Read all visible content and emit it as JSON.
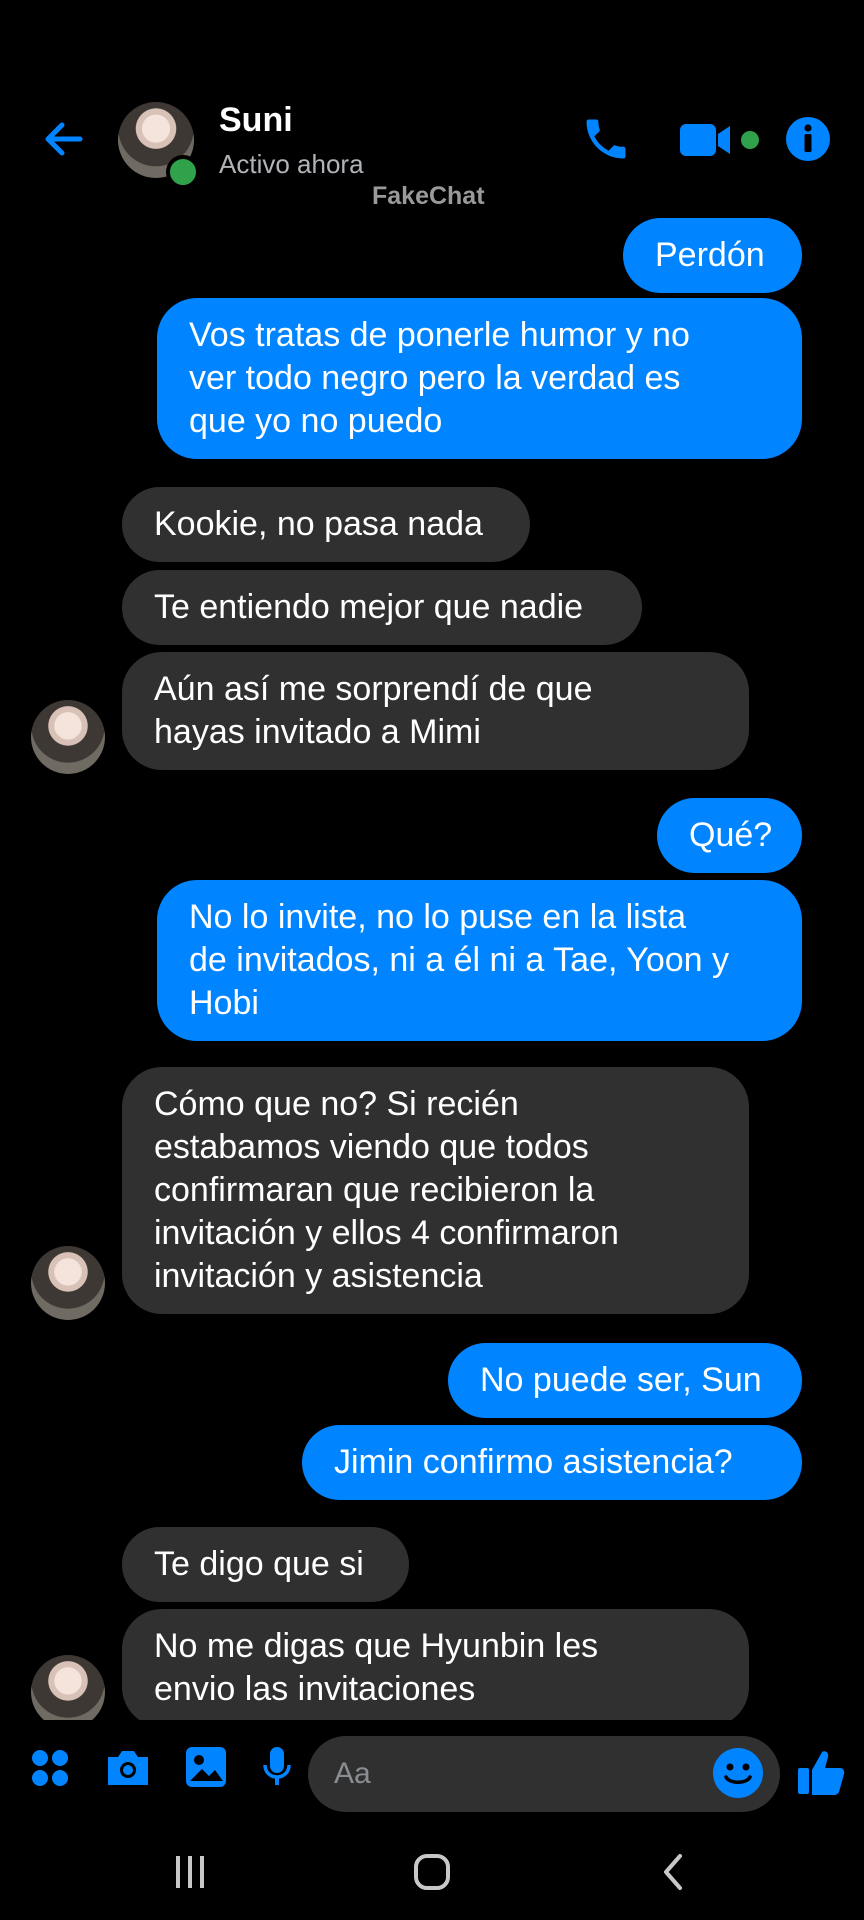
{
  "contact": {
    "name": "Suni",
    "status": "Activo ahora"
  },
  "watermark": "FakeChat",
  "colors": {
    "accent": "#0084ff",
    "incoming_bubble": "#303030",
    "online": "#31a24c"
  },
  "messages": [
    {
      "dir": "out",
      "text": "Perdón"
    },
    {
      "dir": "out",
      "text": "Vos tratas de ponerle humor y no\nver todo negro pero la verdad es\nque yo no puedo"
    },
    {
      "dir": "in",
      "text": "Kookie, no pasa nada"
    },
    {
      "dir": "in",
      "text": "Te entiendo mejor que nadie"
    },
    {
      "dir": "in",
      "text": "Aún así me sorprendí de que\nhayas invitado a Mimi"
    },
    {
      "dir": "out",
      "text": "Qué?"
    },
    {
      "dir": "out",
      "text": "No lo invite, no lo puse en la lista\nde invitados, ni a él ni a Tae, Yoon y\nHobi"
    },
    {
      "dir": "in",
      "text": "Cómo que no? Si recién\nestabamos viendo que todos\nconfirmaran que recibieron la\ninvitación y ellos 4 confirmaron\ninvitación y asistencia"
    },
    {
      "dir": "out",
      "text": "No puede ser, Sun"
    },
    {
      "dir": "out",
      "text": "Jimin confirmo asistencia?"
    },
    {
      "dir": "in",
      "text": "Te digo que si"
    },
    {
      "dir": "in",
      "text": "No me digas que Hyunbin les\nenvio las invitaciones"
    }
  ],
  "composer": {
    "placeholder": "Aa"
  },
  "icons": [
    "back-arrow-icon",
    "phone-icon",
    "video-camera-icon",
    "info-icon",
    "apps-icon",
    "camera-icon",
    "gallery-icon",
    "microphone-icon",
    "emoji-icon",
    "thumbs-up-icon",
    "recent-apps-icon",
    "home-icon",
    "back-nav-icon"
  ]
}
